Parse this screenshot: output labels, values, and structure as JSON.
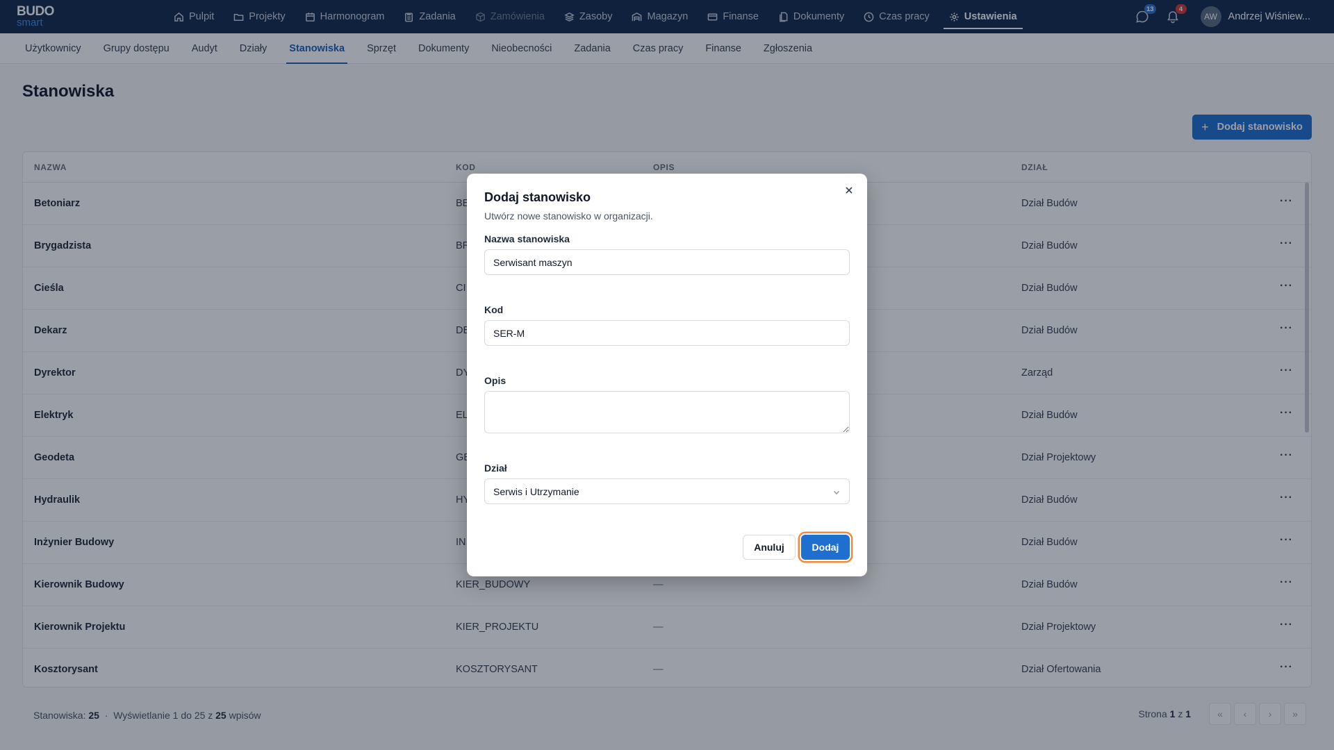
{
  "logo": {
    "line1": "BUDO",
    "line2": "smart"
  },
  "nav": [
    {
      "label": "Pulpit",
      "icon": "home-icon"
    },
    {
      "label": "Projekty",
      "icon": "folder-icon"
    },
    {
      "label": "Harmonogram",
      "icon": "calendar-icon"
    },
    {
      "label": "Zadania",
      "icon": "clipboard-icon"
    },
    {
      "label": "Zamówienia",
      "icon": "package-icon"
    },
    {
      "label": "Zasoby",
      "icon": "layers-icon"
    },
    {
      "label": "Magazyn",
      "icon": "warehouse-icon"
    },
    {
      "label": "Finanse",
      "icon": "card-icon"
    },
    {
      "label": "Dokumenty",
      "icon": "document-icon"
    },
    {
      "label": "Czas pracy",
      "icon": "clock-icon"
    },
    {
      "label": "Ustawienia",
      "icon": "gear-icon"
    }
  ],
  "topbar": {
    "messages_count": "13",
    "notifications_count": "4",
    "avatar_initials": "AW",
    "user_name": "Andrzej Wiśniew..."
  },
  "subnav": [
    "Użytkownicy",
    "Grupy dostępu",
    "Audyt",
    "Działy",
    "Stanowiska",
    "Sprzęt",
    "Dokumenty",
    "Nieobecności",
    "Zadania",
    "Czas pracy",
    "Finanse",
    "Zgłoszenia"
  ],
  "page": {
    "title": "Stanowiska",
    "add_button": "Dodaj stanowisko"
  },
  "table": {
    "headers": {
      "name": "NAZWA",
      "code": "KOD",
      "desc": "OPIS",
      "dept": "DZIAŁ"
    },
    "rows": [
      {
        "name": "Betoniarz",
        "code": "BE",
        "desc": "",
        "dept": "Dział Budów"
      },
      {
        "name": "Brygadzista",
        "code": "BR",
        "desc": "",
        "dept": "Dział Budów"
      },
      {
        "name": "Cieśla",
        "code": "CI",
        "desc": "",
        "dept": "Dział Budów"
      },
      {
        "name": "Dekarz",
        "code": "DE",
        "desc": "",
        "dept": "Dział Budów"
      },
      {
        "name": "Dyrektor",
        "code": "DY",
        "desc": "",
        "dept": "Zarząd"
      },
      {
        "name": "Elektryk",
        "code": "EL",
        "desc": "",
        "dept": "Dział Budów"
      },
      {
        "name": "Geodeta",
        "code": "GE",
        "desc": "",
        "dept": "Dział Projektowy"
      },
      {
        "name": "Hydraulik",
        "code": "HY",
        "desc": "",
        "dept": "Dział Budów"
      },
      {
        "name": "Inżynier Budowy",
        "code": "IN",
        "desc": "",
        "dept": "Dział Budów"
      },
      {
        "name": "Kierownik Budowy",
        "code": "KIER_BUDOWY",
        "desc": "—",
        "dept": "Dział Budów"
      },
      {
        "name": "Kierownik Projektu",
        "code": "KIER_PROJEKTU",
        "desc": "—",
        "dept": "Dział Projektowy"
      },
      {
        "name": "Kosztorysant",
        "code": "KOSZTORYSANT",
        "desc": "—",
        "dept": "Dział Ofertowania"
      }
    ],
    "row_menu": "···"
  },
  "footer": {
    "count_label": "Stanowiska:",
    "count": "25",
    "separator": "·",
    "showing_prefix": "Wyświetlanie 1 do 25 z",
    "showing_total": "25",
    "showing_suffix": "wpisów",
    "page_prefix": "Strona",
    "page_current": "1",
    "page_of": "z",
    "page_total": "1"
  },
  "modal": {
    "title": "Dodaj stanowisko",
    "subtitle": "Utwórz nowe stanowisko w organizacji.",
    "name_label": "Nazwa stanowiska",
    "name_value": "Serwisant maszyn",
    "code_label": "Kod",
    "code_value": "SER-M",
    "desc_label": "Opis",
    "desc_value": "",
    "dept_label": "Dział",
    "dept_value": "Serwis i Utrzymanie",
    "cancel": "Anuluj",
    "submit": "Dodaj"
  }
}
